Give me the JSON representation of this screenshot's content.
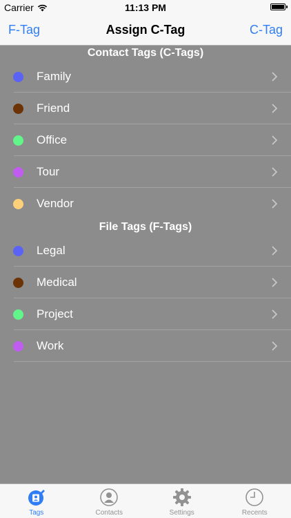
{
  "status_bar": {
    "carrier": "Carrier",
    "time": "11:13 PM"
  },
  "nav": {
    "left_label": "F-Tag",
    "title": "Assign C-Tag",
    "right_label": "C-Tag"
  },
  "sections": [
    {
      "header": "Contact Tags (C-Tags)",
      "items": [
        {
          "label": "Family",
          "color": "#5b63f5"
        },
        {
          "label": "Friend",
          "color": "#6b3306"
        },
        {
          "label": "Office",
          "color": "#62f58a"
        },
        {
          "label": "Tour",
          "color": "#c15cf0"
        },
        {
          "label": "Vendor",
          "color": "#ffd07a"
        }
      ]
    },
    {
      "header": "File Tags (F-Tags)",
      "items": [
        {
          "label": "Legal",
          "color": "#5b63f5"
        },
        {
          "label": "Medical",
          "color": "#6b3306"
        },
        {
          "label": "Project",
          "color": "#62f58a"
        },
        {
          "label": "Work",
          "color": "#c15cf0"
        }
      ]
    }
  ],
  "tab_bar": {
    "tabs": [
      {
        "label": "Tags",
        "icon": "contacts-book-icon",
        "active": true
      },
      {
        "label": "Contacts",
        "icon": "person-icon",
        "active": false
      },
      {
        "label": "Settings",
        "icon": "gear-icon",
        "active": false
      },
      {
        "label": "Recents",
        "icon": "clock-icon",
        "active": false
      }
    ]
  },
  "colors": {
    "accent": "#2f7ef6",
    "background": "#8c8c8c"
  }
}
